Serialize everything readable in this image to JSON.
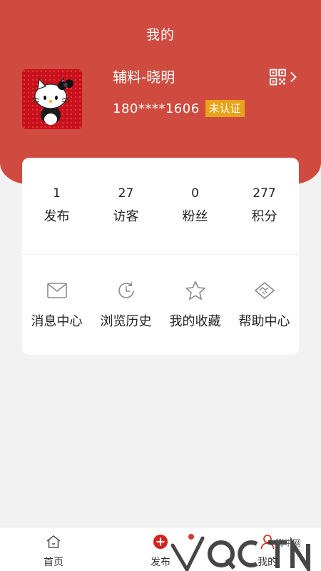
{
  "header": {
    "title": "我的"
  },
  "profile": {
    "name": "辅料-晓明",
    "phone": "180****1606",
    "verify_status": "未认证",
    "avatar_icon": "hello-kitty-avatar",
    "qr_icon": "qr-code-icon"
  },
  "stats": [
    {
      "value": "1",
      "label": "发布"
    },
    {
      "value": "27",
      "label": "访客"
    },
    {
      "value": "0",
      "label": "粉丝"
    },
    {
      "value": "277",
      "label": "积分"
    }
  ],
  "menu": [
    {
      "label": "消息中心",
      "icon": "mail-icon"
    },
    {
      "label": "浏览历史",
      "icon": "history-clock-icon"
    },
    {
      "label": "我的收藏",
      "icon": "star-icon"
    },
    {
      "label": "帮助中心",
      "icon": "handshake-icon"
    }
  ],
  "nav": [
    {
      "label": "首页",
      "icon": "home-icon"
    },
    {
      "label": "发布",
      "icon": "plus-circle-icon"
    },
    {
      "label": "我的",
      "icon": "user-icon"
    }
  ],
  "watermark": {
    "text": "腾牛网"
  },
  "colors": {
    "accent_red": "#d04b3f",
    "badge_orange": "#e9a319",
    "publish_red": "#d2241b"
  }
}
